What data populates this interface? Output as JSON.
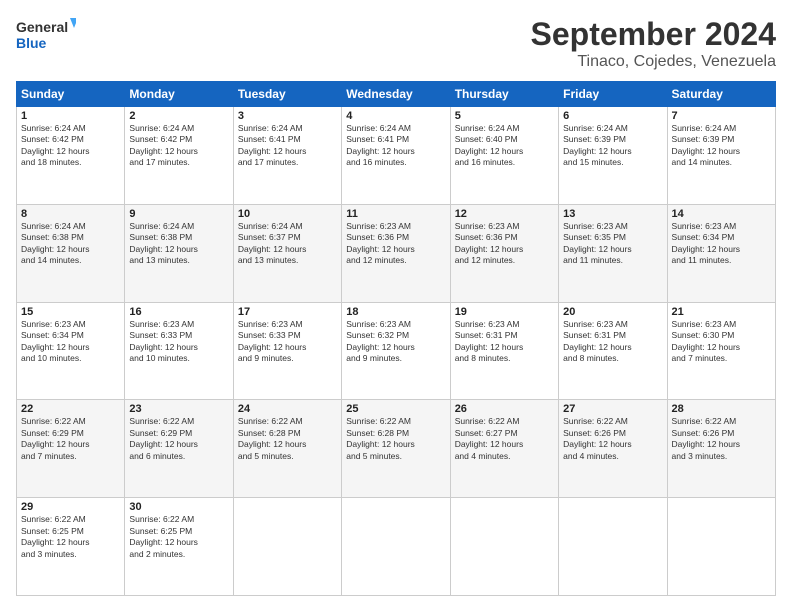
{
  "logo": {
    "line1": "General",
    "line2": "Blue"
  },
  "title": "September 2024",
  "subtitle": "Tinaco, Cojedes, Venezuela",
  "days_of_week": [
    "Sunday",
    "Monday",
    "Tuesday",
    "Wednesday",
    "Thursday",
    "Friday",
    "Saturday"
  ],
  "weeks": [
    [
      {
        "day": "1",
        "sunrise": "6:24 AM",
        "sunset": "6:42 PM",
        "daylight": "12 hours and 18 minutes."
      },
      {
        "day": "2",
        "sunrise": "6:24 AM",
        "sunset": "6:42 PM",
        "daylight": "12 hours and 17 minutes."
      },
      {
        "day": "3",
        "sunrise": "6:24 AM",
        "sunset": "6:41 PM",
        "daylight": "12 hours and 17 minutes."
      },
      {
        "day": "4",
        "sunrise": "6:24 AM",
        "sunset": "6:41 PM",
        "daylight": "12 hours and 16 minutes."
      },
      {
        "day": "5",
        "sunrise": "6:24 AM",
        "sunset": "6:40 PM",
        "daylight": "12 hours and 16 minutes."
      },
      {
        "day": "6",
        "sunrise": "6:24 AM",
        "sunset": "6:39 PM",
        "daylight": "12 hours and 15 minutes."
      },
      {
        "day": "7",
        "sunrise": "6:24 AM",
        "sunset": "6:39 PM",
        "daylight": "12 hours and 14 minutes."
      }
    ],
    [
      {
        "day": "8",
        "sunrise": "6:24 AM",
        "sunset": "6:38 PM",
        "daylight": "12 hours and 14 minutes."
      },
      {
        "day": "9",
        "sunrise": "6:24 AM",
        "sunset": "6:38 PM",
        "daylight": "12 hours and 13 minutes."
      },
      {
        "day": "10",
        "sunrise": "6:24 AM",
        "sunset": "6:37 PM",
        "daylight": "12 hours and 13 minutes."
      },
      {
        "day": "11",
        "sunrise": "6:23 AM",
        "sunset": "6:36 PM",
        "daylight": "12 hours and 12 minutes."
      },
      {
        "day": "12",
        "sunrise": "6:23 AM",
        "sunset": "6:36 PM",
        "daylight": "12 hours and 12 minutes."
      },
      {
        "day": "13",
        "sunrise": "6:23 AM",
        "sunset": "6:35 PM",
        "daylight": "12 hours and 11 minutes."
      },
      {
        "day": "14",
        "sunrise": "6:23 AM",
        "sunset": "6:34 PM",
        "daylight": "12 hours and 11 minutes."
      }
    ],
    [
      {
        "day": "15",
        "sunrise": "6:23 AM",
        "sunset": "6:34 PM",
        "daylight": "12 hours and 10 minutes."
      },
      {
        "day": "16",
        "sunrise": "6:23 AM",
        "sunset": "6:33 PM",
        "daylight": "12 hours and 10 minutes."
      },
      {
        "day": "17",
        "sunrise": "6:23 AM",
        "sunset": "6:33 PM",
        "daylight": "12 hours and 9 minutes."
      },
      {
        "day": "18",
        "sunrise": "6:23 AM",
        "sunset": "6:32 PM",
        "daylight": "12 hours and 9 minutes."
      },
      {
        "day": "19",
        "sunrise": "6:23 AM",
        "sunset": "6:31 PM",
        "daylight": "12 hours and 8 minutes."
      },
      {
        "day": "20",
        "sunrise": "6:23 AM",
        "sunset": "6:31 PM",
        "daylight": "12 hours and 8 minutes."
      },
      {
        "day": "21",
        "sunrise": "6:23 AM",
        "sunset": "6:30 PM",
        "daylight": "12 hours and 7 minutes."
      }
    ],
    [
      {
        "day": "22",
        "sunrise": "6:22 AM",
        "sunset": "6:29 PM",
        "daylight": "12 hours and 7 minutes."
      },
      {
        "day": "23",
        "sunrise": "6:22 AM",
        "sunset": "6:29 PM",
        "daylight": "12 hours and 6 minutes."
      },
      {
        "day": "24",
        "sunrise": "6:22 AM",
        "sunset": "6:28 PM",
        "daylight": "12 hours and 5 minutes."
      },
      {
        "day": "25",
        "sunrise": "6:22 AM",
        "sunset": "6:28 PM",
        "daylight": "12 hours and 5 minutes."
      },
      {
        "day": "26",
        "sunrise": "6:22 AM",
        "sunset": "6:27 PM",
        "daylight": "12 hours and 4 minutes."
      },
      {
        "day": "27",
        "sunrise": "6:22 AM",
        "sunset": "6:26 PM",
        "daylight": "12 hours and 4 minutes."
      },
      {
        "day": "28",
        "sunrise": "6:22 AM",
        "sunset": "6:26 PM",
        "daylight": "12 hours and 3 minutes."
      }
    ],
    [
      {
        "day": "29",
        "sunrise": "6:22 AM",
        "sunset": "6:25 PM",
        "daylight": "12 hours and 3 minutes."
      },
      {
        "day": "30",
        "sunrise": "6:22 AM",
        "sunset": "6:25 PM",
        "daylight": "12 hours and 2 minutes."
      },
      null,
      null,
      null,
      null,
      null
    ]
  ],
  "labels": {
    "sunrise": "Sunrise:",
    "sunset": "Sunset:",
    "daylight": "Daylight:"
  }
}
